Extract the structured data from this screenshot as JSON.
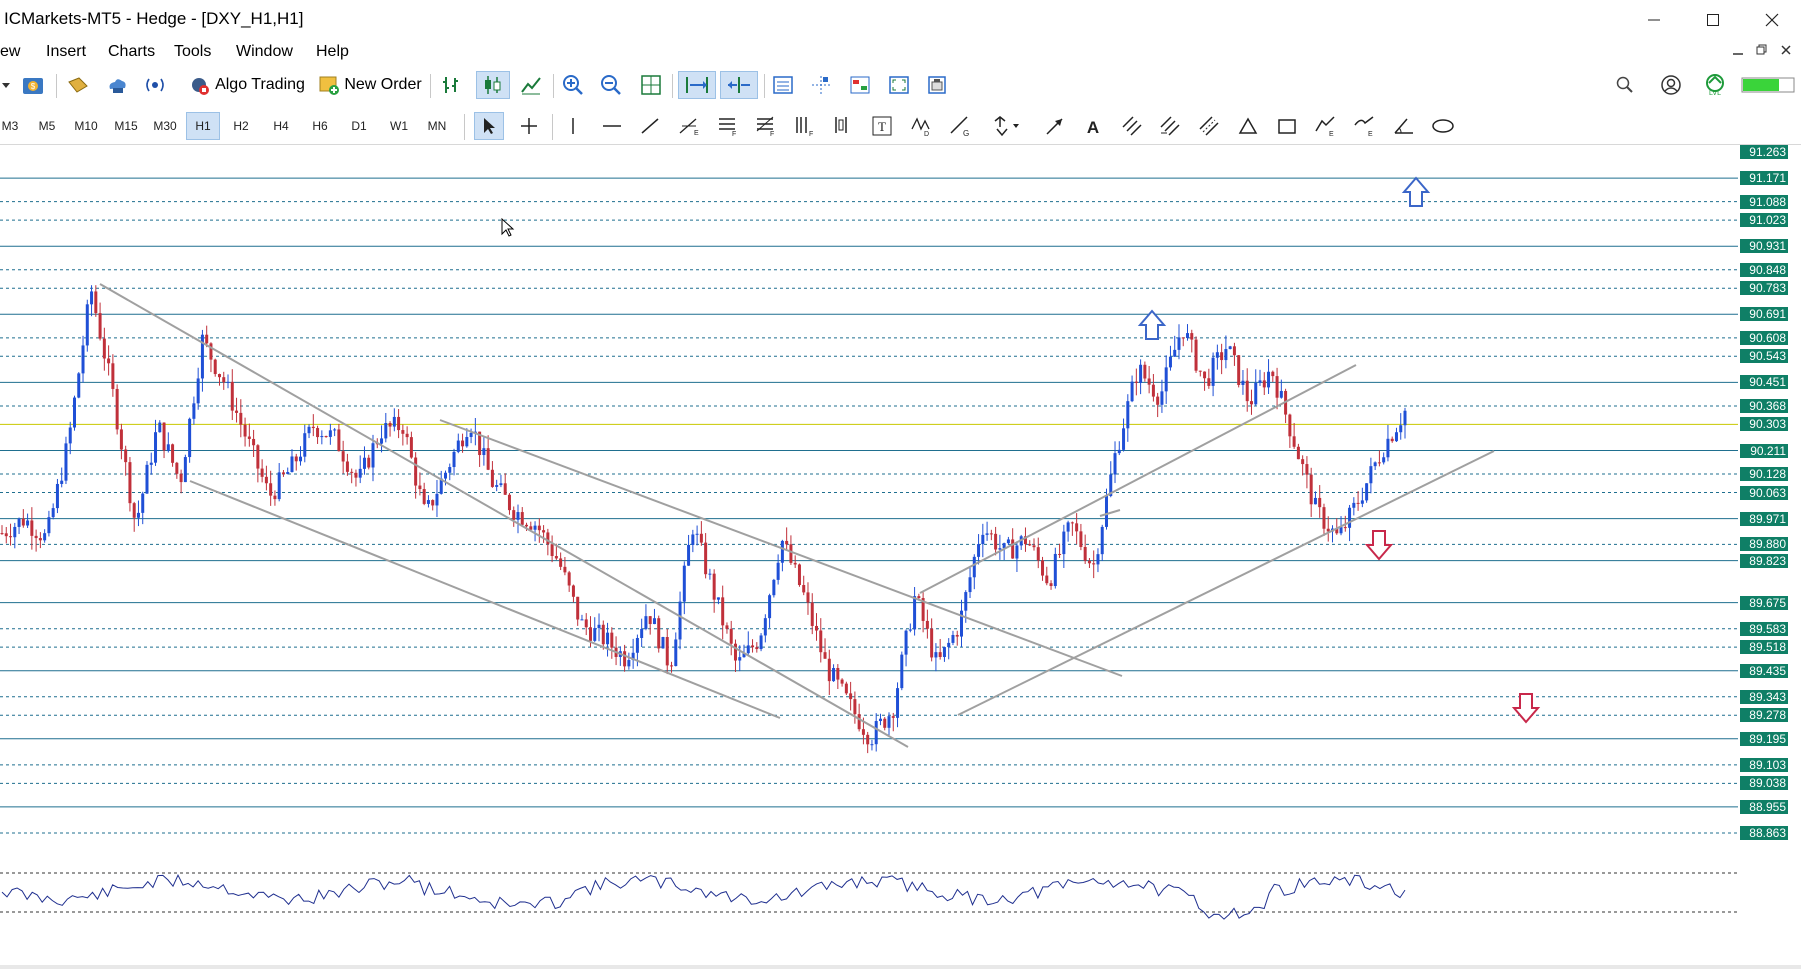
{
  "window": {
    "title": "ICMarkets-MT5 - Hedge - [DXY_H1,H1]",
    "minimize_icon": "minimize-icon",
    "maximize_icon": "maximize-icon",
    "close_icon": "close-icon"
  },
  "menu": {
    "items": [
      "ew",
      "Insert",
      "Charts",
      "Tools",
      "Window",
      "Help"
    ]
  },
  "toolbar": {
    "algo_trading": "Algo Trading",
    "new_order": "New Order"
  },
  "timeframes": {
    "items": [
      "M3",
      "M5",
      "M10",
      "M15",
      "M30",
      "H1",
      "H2",
      "H4",
      "H6",
      "D1",
      "W1",
      "MN"
    ],
    "selected": "H1"
  },
  "price_axis": {
    "levels": [
      "91.263",
      "91.171",
      "91.088",
      "91.023",
      "90.931",
      "90.848",
      "90.783",
      "90.691",
      "90.608",
      "90.543",
      "90.451",
      "90.368",
      "90.303",
      "90.211",
      "90.128",
      "90.063",
      "89.971",
      "89.880",
      "89.823",
      "89.675",
      "89.583",
      "89.518",
      "89.435",
      "89.343",
      "89.278",
      "89.195",
      "89.103",
      "89.038",
      "88.955",
      "88.863"
    ],
    "current_price": "90.303"
  },
  "chart_data": {
    "type": "candlestick",
    "symbol": "DXY",
    "timeframe": "H1",
    "horizontal_levels_solid": [
      91.171,
      90.931,
      90.691,
      90.451,
      90.211,
      89.971,
      89.823,
      89.675,
      89.435,
      89.195,
      88.955
    ],
    "horizontal_levels_dotted": [
      91.088,
      91.023,
      90.848,
      90.783,
      90.608,
      90.543,
      90.368,
      90.128,
      90.063,
      89.88,
      89.583,
      89.518,
      89.343,
      89.278,
      89.103,
      89.038,
      88.863
    ],
    "current_price_line": 90.303,
    "ylim": [
      88.8,
      91.28
    ],
    "colors": {
      "up_candle": "#1f4fd6",
      "down_candle": "#c0303a",
      "level_line": "#1f6f8f",
      "current_price_line": "#c8c800",
      "trend_line": "#a0a0a0",
      "price_label_bg": "#0f7f66",
      "up_arrow": "#3b66c8",
      "down_arrow": "#c8284a",
      "oscillator": "#1f2f8f"
    },
    "close_path": [
      89.92,
      89.97,
      89.9,
      90.25,
      90.78,
      90.4,
      89.95,
      90.3,
      90.1,
      90.6,
      90.45,
      90.25,
      90.05,
      90.15,
      90.3,
      90.25,
      90.1,
      90.28,
      90.3,
      89.98,
      90.15,
      90.32,
      90.1,
      90.0,
      89.95,
      89.82,
      89.6,
      89.55,
      89.48,
      89.65,
      89.45,
      89.95,
      89.7,
      89.45,
      89.55,
      89.9,
      89.7,
      89.45,
      89.32,
      89.2,
      89.3,
      89.7,
      89.45,
      89.6,
      89.95,
      89.85,
      89.9,
      89.75,
      89.95,
      89.8,
      90.2,
      90.5,
      90.4,
      90.65,
      90.45,
      90.58,
      90.38,
      90.5,
      90.25,
      90.0,
      89.9,
      90.05,
      90.22,
      90.35
    ],
    "oscillator_levels": [
      "upper-dotted",
      "lower-dotted"
    ],
    "annotations": {
      "up_arrows": 2,
      "down_arrows": 2,
      "trend_lines": 6
    }
  }
}
